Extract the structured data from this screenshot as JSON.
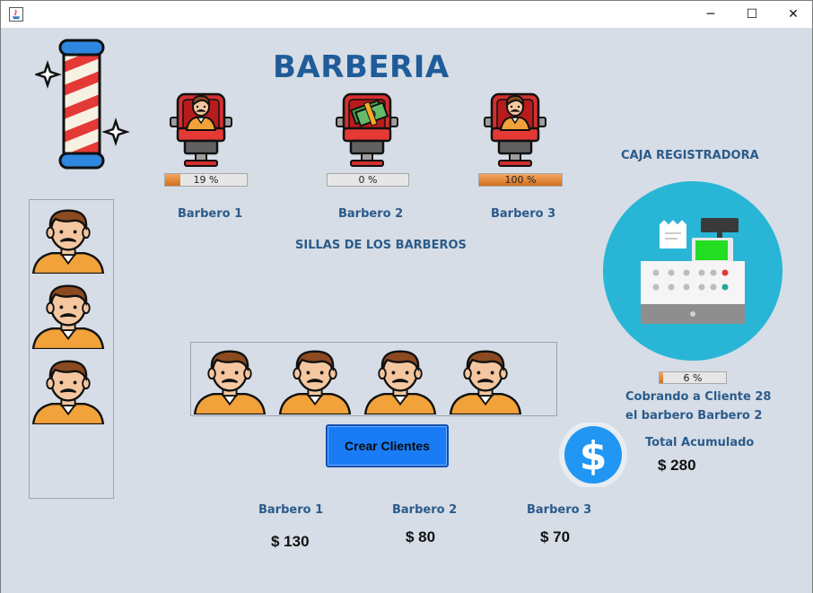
{
  "window": {
    "minimize_icon": "─",
    "maximize_icon": "☐",
    "close_icon": "✕",
    "app_icon": "java-icon"
  },
  "header": {
    "title": "BARBERIA"
  },
  "chairs_section": {
    "label": "SILLAS DE LOS BARBEROS",
    "barbers": [
      {
        "name": "Barbero 1",
        "progress_text": "19 %",
        "progress": 0.19,
        "state": "client-seated"
      },
      {
        "name": "Barbero 2",
        "progress_text": "0 %",
        "progress": 0.0,
        "state": "sleeping"
      },
      {
        "name": "Barbero 3",
        "progress_text": "100 %",
        "progress": 1.0,
        "state": "client-seated"
      }
    ]
  },
  "register": {
    "label": "CAJA REGISTRADORA",
    "progress_text": "6 %",
    "progress": 0.06,
    "status_line1": "Cobrando a Cliente 28",
    "status_line2": "el barbero Barbero 2",
    "total_label": "Total Acumulado",
    "total_value": "$ 280"
  },
  "queue": {
    "count": 3
  },
  "waiting_room": {
    "count": 4
  },
  "actions": {
    "create_clients_label": "Crear Clientes"
  },
  "earnings": [
    {
      "name": "Barbero 1",
      "amount": "$ 130"
    },
    {
      "name": "Barbero 2",
      "amount": "$ 80"
    },
    {
      "name": "Barbero 3",
      "amount": "$ 70"
    }
  ],
  "colors": {
    "title": "#1f5c99",
    "label": "#2b5b8a",
    "button": "#1a7cf5",
    "progress_fill": "#e0832e",
    "background": "#d6dde6"
  }
}
